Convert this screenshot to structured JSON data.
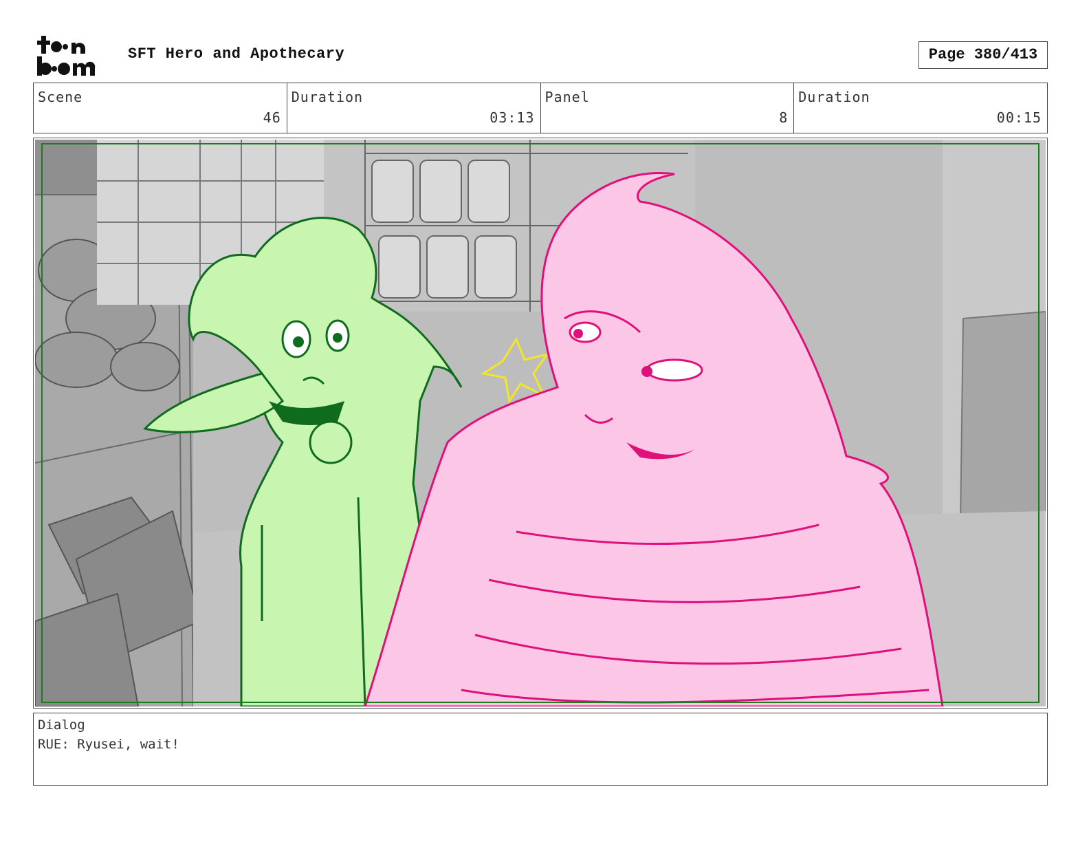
{
  "header": {
    "logo_text": "toon boom",
    "project_title": "SFT Hero and Apothecary",
    "page_label": "Page 380/413"
  },
  "info": {
    "scene_label": "Scene",
    "scene_value": "46",
    "scene_duration_label": "Duration",
    "scene_duration_value": "03:13",
    "panel_label": "Panel",
    "panel_value": "8",
    "panel_duration_label": "Duration",
    "panel_duration_value": "00:15"
  },
  "dialog": {
    "label": "Dialog",
    "text": "RUE: Ryusei, wait!"
  },
  "colors": {
    "safe_frame": "#1e7a1e",
    "character_green_fill": "#c8f5b0",
    "character_green_line": "#0f6b1e",
    "character_pink_fill": "#fcc6e6",
    "character_pink_line": "#e0107a",
    "background_gray": "#b5b5b5",
    "impact_star": "#f2e52a"
  }
}
